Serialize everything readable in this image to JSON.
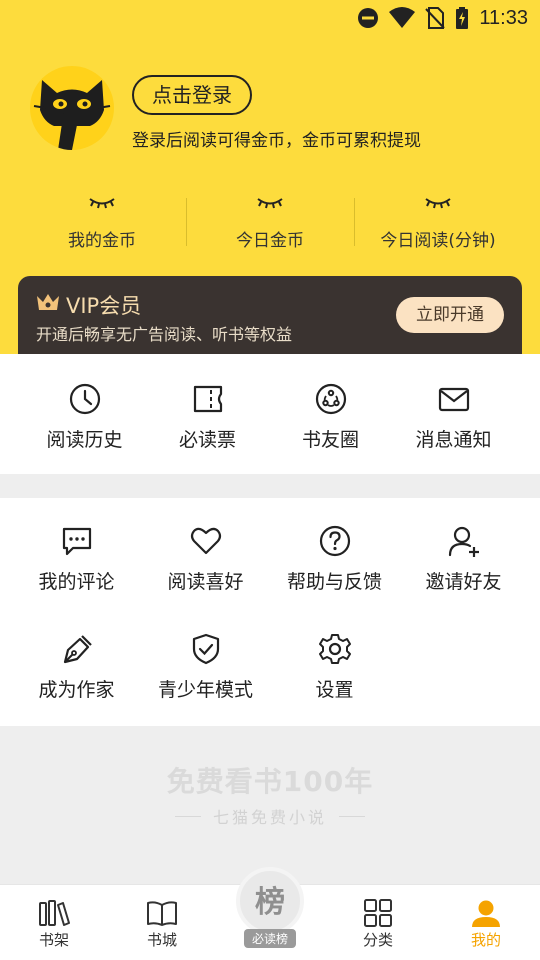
{
  "status_bar": {
    "time": "11:33"
  },
  "profile": {
    "login_label": "点击登录",
    "login_tip": "登录后阅读可得金币，金币可累积提现"
  },
  "stats": [
    {
      "label": "我的金币"
    },
    {
      "label": "今日金币"
    },
    {
      "label": "今日阅读(分钟)"
    }
  ],
  "vip": {
    "title": "VIP会员",
    "desc": "开通后畅享无广告阅读、听书等权益",
    "button": "立即开通"
  },
  "quick_menu": [
    {
      "label": "阅读历史",
      "icon": "clock-icon"
    },
    {
      "label": "必读票",
      "icon": "ticket-icon"
    },
    {
      "label": "书友圈",
      "icon": "circle-icon"
    },
    {
      "label": "消息通知",
      "icon": "mail-icon"
    }
  ],
  "tools_menu": [
    {
      "label": "我的评论",
      "icon": "comment-icon"
    },
    {
      "label": "阅读喜好",
      "icon": "heart-icon"
    },
    {
      "label": "帮助与反馈",
      "icon": "help-icon"
    },
    {
      "label": "邀请好友",
      "icon": "add-user-icon"
    },
    {
      "label": "成为作家",
      "icon": "pen-icon"
    },
    {
      "label": "青少年模式",
      "icon": "shield-icon"
    },
    {
      "label": "设置",
      "icon": "gear-icon"
    }
  ],
  "slogan": {
    "main": "免费看书100年",
    "sub": "七猫免费小说"
  },
  "tabbar": [
    {
      "label": "书架",
      "icon": "bookshelf-icon"
    },
    {
      "label": "书城",
      "icon": "book-icon"
    },
    {
      "label": "必读榜",
      "char": "榜",
      "icon": "rank-icon"
    },
    {
      "label": "分类",
      "icon": "grid-icon"
    },
    {
      "label": "我的",
      "icon": "person-icon",
      "active": true
    }
  ],
  "colors": {
    "header_bg": "#fddc3d",
    "vip_bg": "#3a3330",
    "accent": "#f5a300"
  }
}
